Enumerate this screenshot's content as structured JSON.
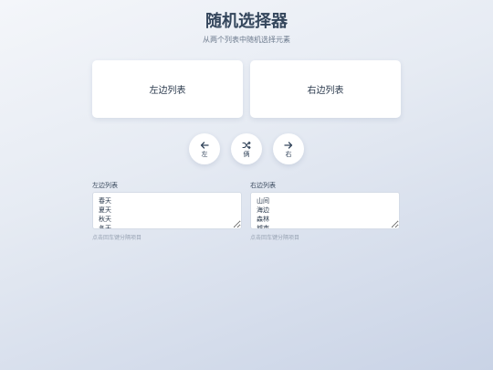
{
  "header": {
    "title": "随机选择器",
    "subtitle": "从两个列表中随机选择元素"
  },
  "cards": {
    "left_label": "左边列表",
    "right_label": "右边列表"
  },
  "buttons": {
    "left_label": "左",
    "random_label": "俩",
    "right_label": "右"
  },
  "left_panel": {
    "label": "左边列表",
    "items": [
      "春天",
      "夏天",
      "秋天",
      "冬天"
    ],
    "hint": "点击回车键分隔项目"
  },
  "right_panel": {
    "label": "右边列表",
    "items": [
      "山间",
      "海边",
      "森林",
      "城市"
    ],
    "hint": "点击回车键分隔项目"
  },
  "icons": {
    "left_button": "arrow-left-icon",
    "random_button": "shuffle-icon",
    "right_button": "arrow-right-icon"
  },
  "colors": {
    "title": "#34465c",
    "card_bg": "#ffffff",
    "hint": "#98a3b3"
  }
}
